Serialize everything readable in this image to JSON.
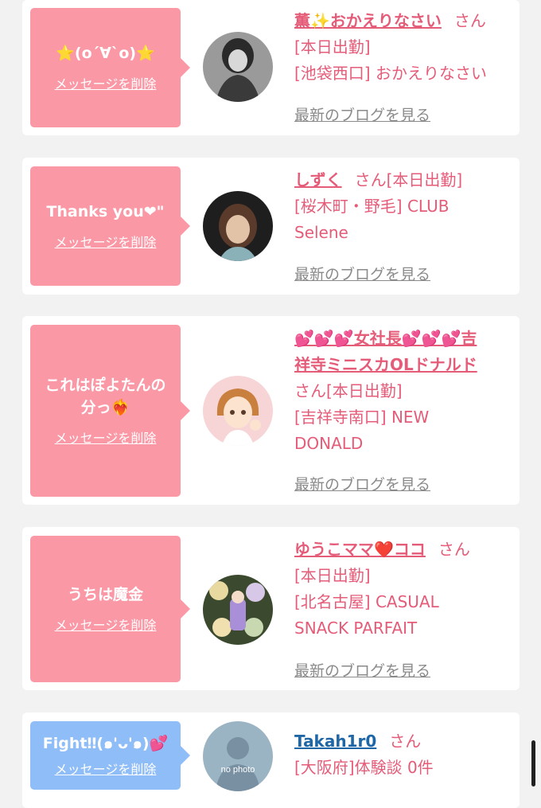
{
  "items": [
    {
      "message": "⭐(o´∀`o)⭐",
      "delete_label": "メッセージを削除",
      "name": "薫✨おかえりなさい",
      "san": "さん",
      "line1": "[本日出勤]",
      "line2": "[池袋西口] おかえりなさい",
      "blog_label": "最新のブログを見る"
    },
    {
      "message": "Thanks you❤\"",
      "delete_label": "メッセージを削除",
      "name": "しずく",
      "san": "さん[本日出勤]",
      "line1": "[桜木町・野毛] CLUB",
      "line2": "Selene",
      "blog_label": "最新のブログを見る"
    },
    {
      "message": "これはぽよたんの\n分っ❤‍🔥",
      "delete_label": "メッセージを削除",
      "name_a": "💕💕💕女社長💕💕💕吉",
      "name_b": "祥寺ミニスカOLドナルド",
      "san": "さん[本日出勤]",
      "line1": "[吉祥寺南口] NEW",
      "line2": "DONALD",
      "blog_label": "最新のブログを見る"
    },
    {
      "message": "うちは魔金",
      "delete_label": "メッセージを削除",
      "name": "ゆうこママ❤️ココ",
      "san": "さん",
      "line1": "[本日出勤]",
      "line2": "[北名古屋] CASUAL",
      "line3": "SNACK PARFAIT",
      "blog_label": "最新のブログを見る"
    },
    {
      "message": "Fight‼(๑'ᴗ'๑)💕",
      "delete_label": "メッセージを削除",
      "name": "Takah1r0",
      "san": "さん",
      "line1": "[大阪府]体験談 0件",
      "avatar_text": "no photo"
    }
  ],
  "colors": {
    "pink_bubble": "#fb98a6",
    "blue_bubble": "#8fbdf7",
    "pink_text": "#e55c79",
    "blue_text": "#1f66a6"
  }
}
